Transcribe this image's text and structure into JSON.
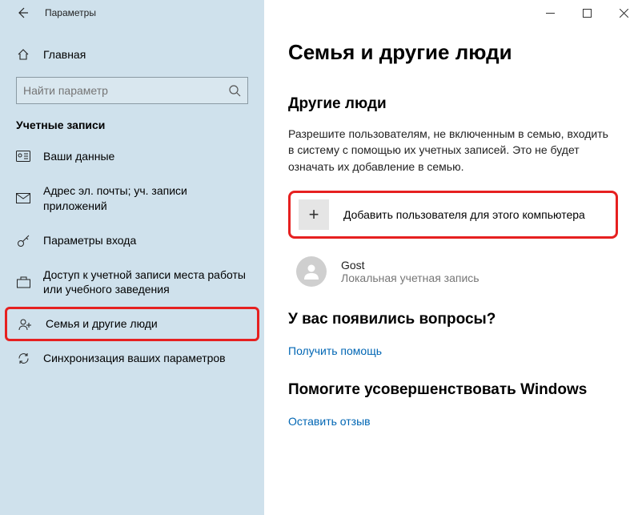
{
  "window": {
    "title": "Параметры"
  },
  "sidebar": {
    "home": "Главная",
    "search_placeholder": "Найти параметр",
    "section": "Учетные записи",
    "items": [
      {
        "label": "Ваши данные"
      },
      {
        "label": "Адрес эл. почты; уч. записи приложений"
      },
      {
        "label": "Параметры входа"
      },
      {
        "label": "Доступ к учетной записи места работы или учебного заведения"
      },
      {
        "label": "Семья и другие люди"
      },
      {
        "label": "Синхронизация ваших параметров"
      }
    ]
  },
  "content": {
    "title": "Семья и другие люди",
    "other_people": {
      "heading": "Другие люди",
      "description": "Разрешите пользователям, не включенным в семью, входить в систему с помощью их учетных записей. Это не будет означать их добавление в семью.",
      "add_label": "Добавить пользователя для этого компьютера",
      "user": {
        "name": "Gost",
        "type": "Локальная учетная запись"
      }
    },
    "questions": {
      "heading": "У вас появились вопросы?",
      "link": "Получить помощь"
    },
    "improve": {
      "heading": "Помогите усовершенствовать Windows",
      "link": "Оставить отзыв"
    }
  }
}
